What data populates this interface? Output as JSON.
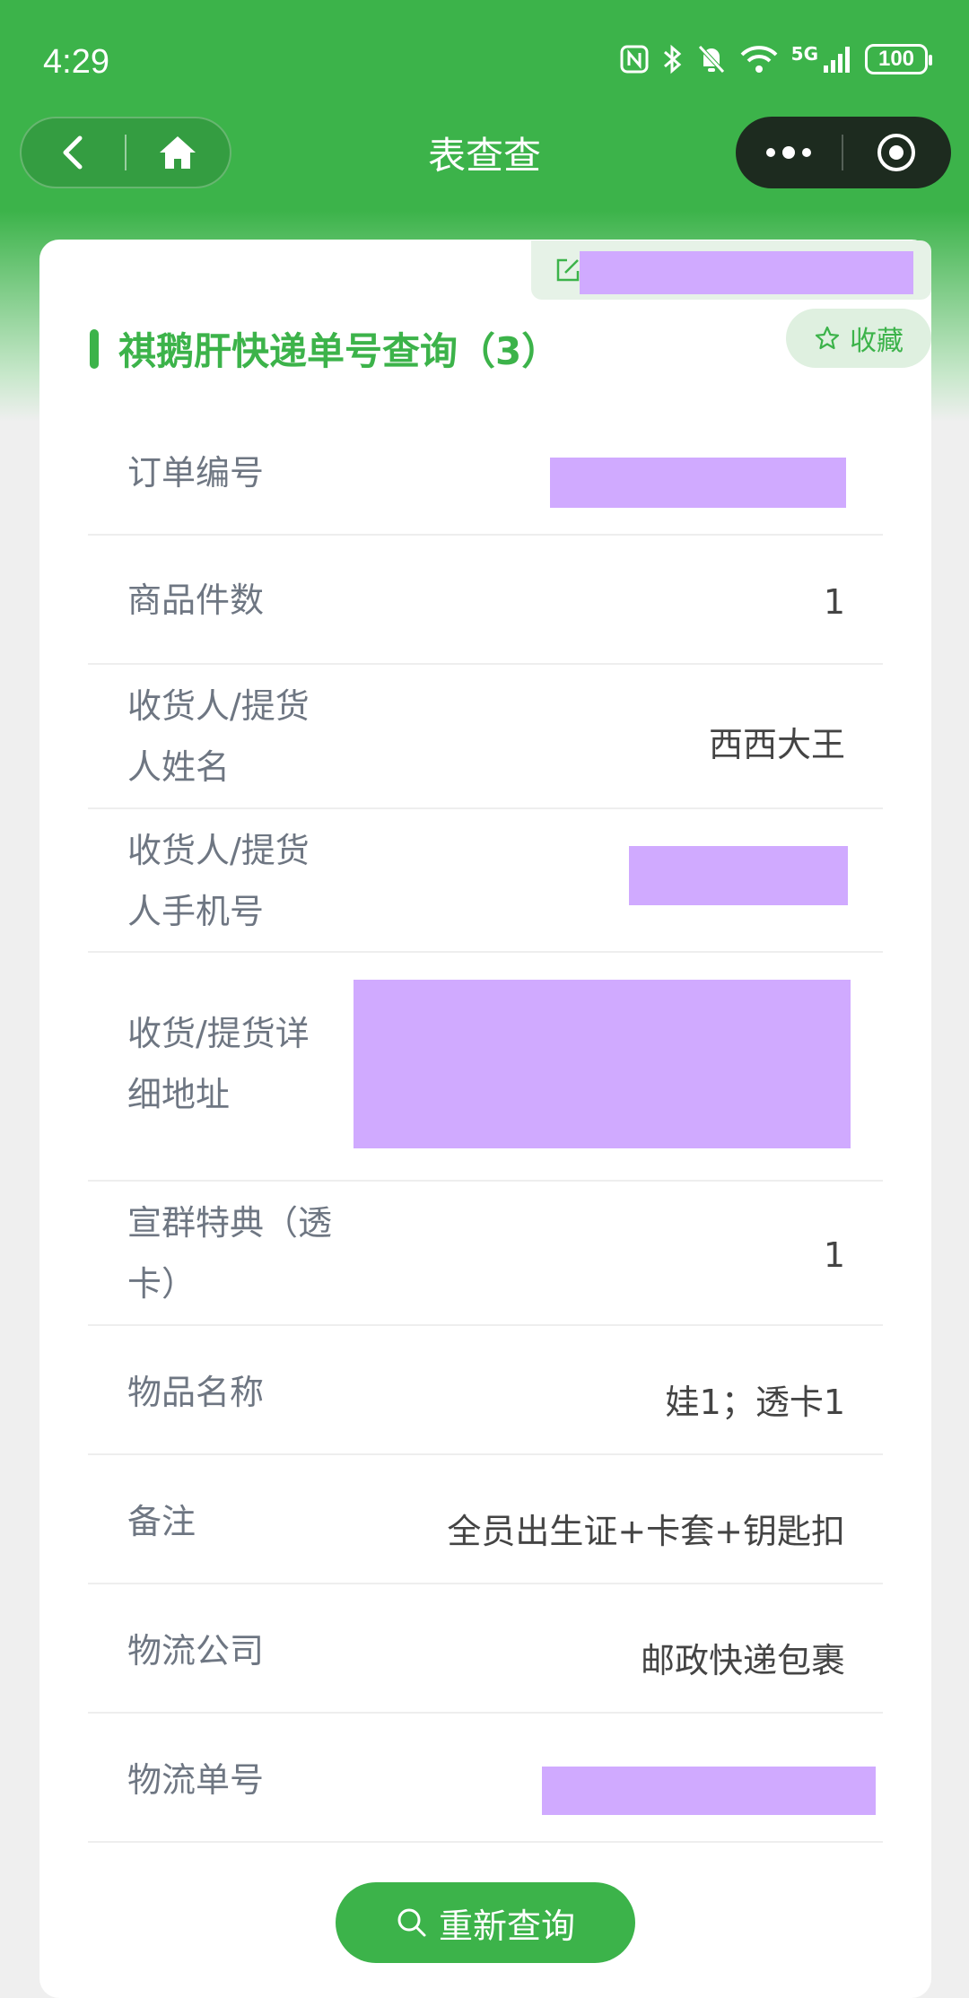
{
  "status_bar": {
    "time": "4:29",
    "battery": "100",
    "network": "5G"
  },
  "nav": {
    "title": "表查查"
  },
  "header": {
    "title": "祺鹅肝快递单号查询（3）",
    "favorite_label": "收藏"
  },
  "fields": [
    {
      "label": "订单编号",
      "value": ""
    },
    {
      "label": "商品件数",
      "value": "1"
    },
    {
      "label": "收货人/提货人姓名",
      "value": "西西大王"
    },
    {
      "label": "收货人/提货人手机号",
      "value": ""
    },
    {
      "label": "收货/提货详细地址",
      "value": ""
    },
    {
      "label": "宣群特典（透卡）",
      "value": "1"
    },
    {
      "label": "物品名称",
      "value": "娃1；透卡1"
    },
    {
      "label": "备注",
      "value": "全员出生证+卡套+钥匙扣"
    },
    {
      "label": "物流公司",
      "value": "邮政快递包裹"
    },
    {
      "label": "物流单号",
      "value": ""
    }
  ],
  "actions": {
    "requery_label": "重新查询"
  },
  "colors": {
    "primary": "#3cb34a",
    "redaction": "#d0aaff",
    "capsule": "#1d2b1f"
  },
  "icons": [
    "back-icon",
    "home-icon",
    "more-icon",
    "target-icon",
    "edit-icon",
    "star-icon",
    "search-icon"
  ]
}
